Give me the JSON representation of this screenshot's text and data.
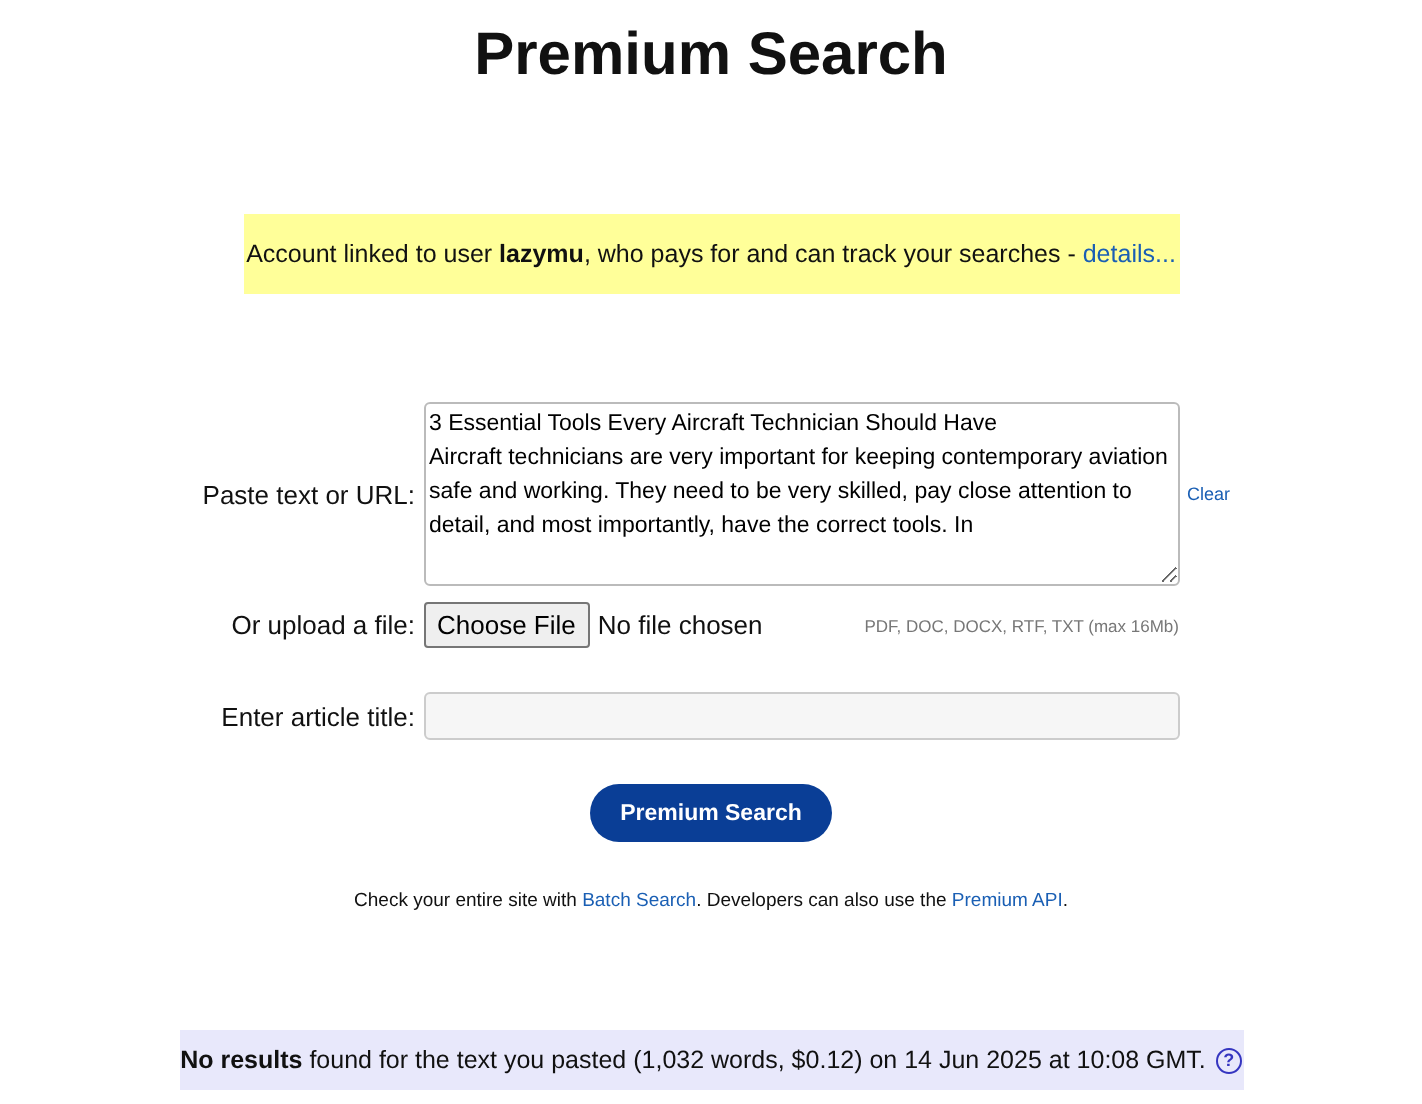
{
  "title": "Premium Search",
  "notice": {
    "text": "Account linked to user **lazymu**, who pays for and can track your searches - ",
    "link": "details..."
  },
  "form": {
    "paste_label": "Paste text or URL:",
    "paste_value": "3 Essential Tools Every Aircraft Technician Should Have\nAircraft technicians are very important for keeping contemporary aviation safe and working. They need to be very skilled, pay close attention to detail, and most importantly, have the correct tools. In",
    "clear_link": "Clear",
    "upload_label": "Or upload a file:",
    "choose_button": "Choose File",
    "file_status": "No file chosen",
    "file_hint": "PDF, DOC, DOCX, RTF, TXT (max 16Mb)",
    "title_label": "Enter article title:"
  },
  "search_button": "Premium Search",
  "footer": {
    "before": "Check your entire site with ",
    "link1": "Batch Search",
    "middle": ". Developers can also use the ",
    "link2": "Premium API",
    "after": "."
  },
  "result": {
    "text": "**No results** found for the text you pasted (1,032 words, $0.12) on 14 Jun 2025 at 10:08 GMT.",
    "help": "?"
  }
}
